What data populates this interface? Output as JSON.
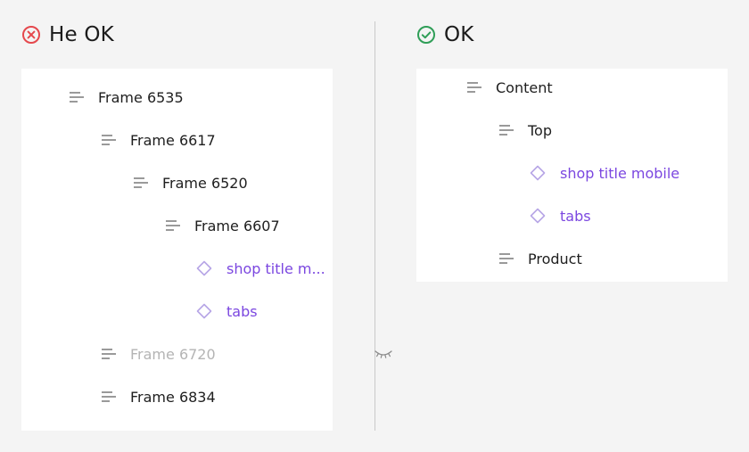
{
  "bad_example": {
    "title": "He OK",
    "layers": [
      {
        "label": "Frame 6535",
        "type": "frame",
        "depth": 0
      },
      {
        "label": "Frame 6617",
        "type": "frame",
        "depth": 1
      },
      {
        "label": "Frame 6520",
        "type": "frame",
        "depth": 2
      },
      {
        "label": "Frame 6607",
        "type": "frame",
        "depth": 3
      },
      {
        "label": "shop title m...",
        "type": "component",
        "depth": 4
      },
      {
        "label": "tabs",
        "type": "component",
        "depth": 4
      },
      {
        "label": "Frame 6720",
        "type": "frame",
        "depth": 1,
        "hidden": true
      },
      {
        "label": "Frame 6834",
        "type": "frame",
        "depth": 1
      }
    ]
  },
  "good_example": {
    "title": "OK",
    "layers": [
      {
        "label": "Content",
        "type": "frame",
        "depth": 0
      },
      {
        "label": "Top",
        "type": "frame",
        "depth": 1
      },
      {
        "label": "shop title mobile",
        "type": "component",
        "depth": 2
      },
      {
        "label": "tabs",
        "type": "component",
        "depth": 2
      },
      {
        "label": "Product",
        "type": "frame",
        "depth": 1
      }
    ]
  },
  "icons": {
    "bad_status": "error-x-circle-icon",
    "good_status": "success-check-circle-icon",
    "frame": "auto-layout-frame-icon",
    "component": "component-instance-diamond-icon",
    "hidden": "hidden-eye-icon"
  },
  "colors": {
    "background": "#f4f4f4",
    "panel": "#ffffff",
    "error": "#e5484d",
    "success": "#2f9e57",
    "component": "#7b47e0",
    "component_icon": "#b7a6e6",
    "frame_icon": "#9a9a9a",
    "hidden_text": "#b4b4b4",
    "divider": "#c9c9c9"
  }
}
